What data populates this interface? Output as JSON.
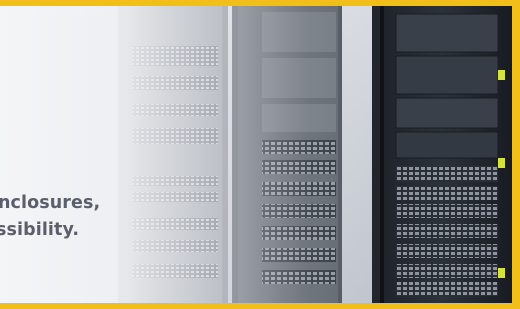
{
  "banner": {
    "caption_line_1": "enclosures,",
    "caption_line_2": "essibility.",
    "image_subject": "server racks in a data center",
    "accent_color": "#f2bf1a"
  }
}
